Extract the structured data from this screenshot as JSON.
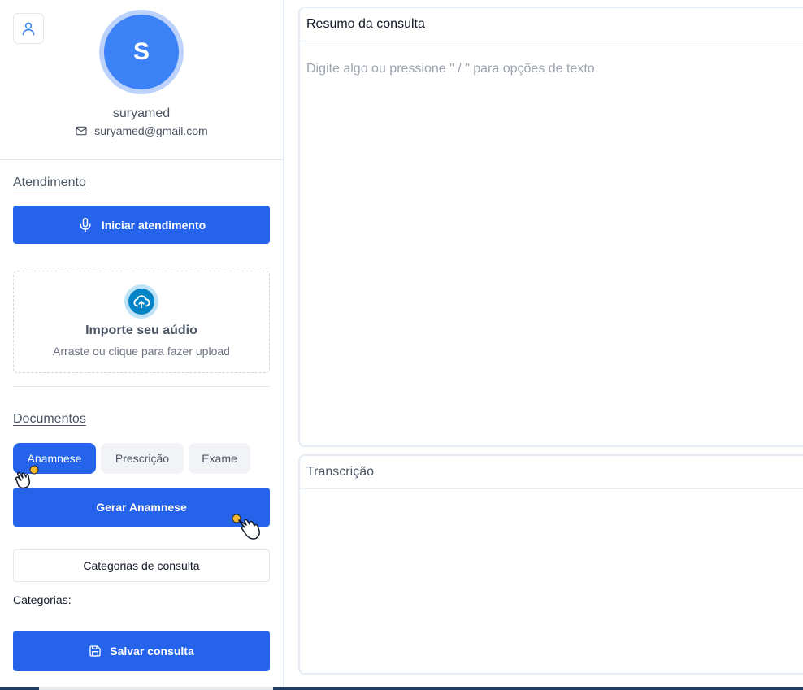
{
  "user": {
    "initial": "S",
    "name": "suryamed",
    "email": "suryamed@gmail.com"
  },
  "atendimento": {
    "title": "Atendimento",
    "start_label": "Iniciar atendimento"
  },
  "upload": {
    "title": "Importe seu aúdio",
    "subtitle": "Arraste ou clique para fazer upload"
  },
  "documentos": {
    "title": "Documentos",
    "tabs": [
      {
        "label": "Anamnese",
        "active": true
      },
      {
        "label": "Prescrição",
        "active": false
      },
      {
        "label": "Exame",
        "active": false
      }
    ],
    "generate_label": "Gerar Anamnese",
    "categories_button": "Categorias de consulta",
    "categories_label": "Categorias:",
    "save_label": "Salvar consulta"
  },
  "resumo": {
    "title": "Resumo da consulta",
    "placeholder": "Digite algo ou pressione \" / \" para opções de texto"
  },
  "transcricao": {
    "title": "Transcrição"
  },
  "colors": {
    "primary": "#2563eb",
    "avatar": "#3b82f6",
    "upload_icon": "#0284c7",
    "cursor_dot": "#f5b82e"
  },
  "icons": {
    "user_button": "user-icon",
    "email": "mail-icon",
    "start": "microphone-icon",
    "upload": "cloud-upload-icon",
    "save": "floppy-disk-icon",
    "cursor": "hand-pointer-icon"
  }
}
